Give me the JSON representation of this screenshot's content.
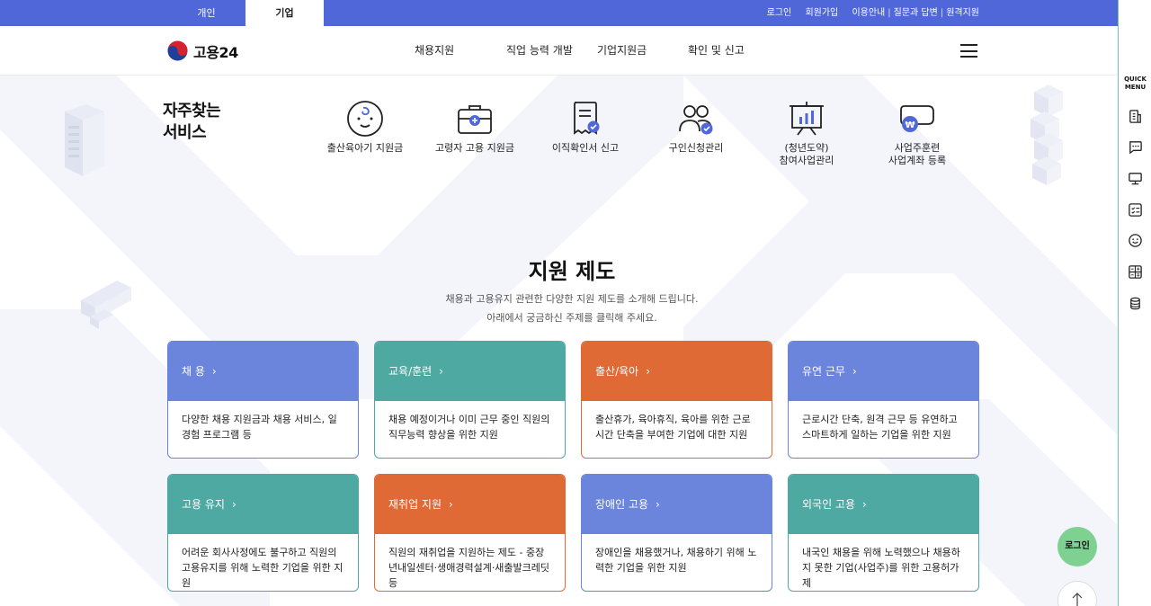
{
  "top_bar": {
    "tabs": [
      {
        "label": "개인"
      },
      {
        "label": "기업"
      }
    ],
    "links": [
      "로그인",
      "회원가입",
      "이용안내",
      "질문과 답변",
      "원격지원"
    ]
  },
  "header": {
    "logo_text": "고용24",
    "nav": [
      "채용지원",
      "직업 능력 개발",
      "기업지원금",
      "확인 및 신고"
    ]
  },
  "frequent_services": {
    "title": "자주찾는\n서비스",
    "items": [
      {
        "label": "출산육아기 지원금",
        "icon": "baby-icon"
      },
      {
        "label": "고령자 고용 지원금",
        "icon": "briefcase-plus-icon"
      },
      {
        "label": "이직확인서 신고",
        "icon": "document-check-icon"
      },
      {
        "label": "구인신청관리",
        "icon": "people-check-icon"
      },
      {
        "label": "(청년도약)\n참여사업관리",
        "icon": "presentation-chart-icon"
      },
      {
        "label": "사업주훈련\n사업계좌 등록",
        "icon": "wallet-won-icon"
      }
    ]
  },
  "support_section": {
    "title": "지원 제도",
    "desc_line1": "채용과 고용유지 관련한 다양한 지원 제도를 소개해 드립니다.",
    "desc_line2": "아래에서 궁금하신 주제를 클릭해 주세요.",
    "cards": [
      {
        "title": "채 용",
        "desc": "다양한 채용 지원금과 채용 서비스, 일 경험 프로그램 등",
        "color": "#6b84dc"
      },
      {
        "title": "교육/훈련",
        "desc": "채용 예정이거나 이미 근무 중인 직원의 직무능력 향상을 위한 지원",
        "color": "#4fa9a3"
      },
      {
        "title": "출산/육아",
        "desc": "출산휴가, 육아휴직, 육아를 위한 근로시간 단축을 부여한 기업에 대한 지원",
        "color": "#e06a35"
      },
      {
        "title": "유연 근무",
        "desc": "근로시간 단축, 원격 근무 등 유연하고 스마트하게 일하는 기업을 위한 지원",
        "color": "#6b84dc"
      },
      {
        "title": "고용 유지",
        "desc": "어려운 회사사정에도 불구하고 직원의 고용유지를 위해 노력한 기업을 위한 지원",
        "color": "#4fa9a3"
      },
      {
        "title": "재취업 지원",
        "desc": "직원의 재취업을 지원하는 제도 - 중장년내일센터·생애경력설계·새출발크레딧 등",
        "color": "#e06a35"
      },
      {
        "title": "장애인 고용",
        "desc": "장애인을 채용했거나, 채용하기 위해 노력한 기업을 위한 지원",
        "color": "#6b84dc"
      },
      {
        "title": "외국인 고용",
        "desc": "내국인 채용을 위해 노력했으나 채용하지 못한 기업(사업주)를 위한 고용허가제",
        "color": "#4fa9a3"
      }
    ]
  },
  "quick_menu": {
    "title_line1": "QUICK",
    "title_line2": "MENU",
    "icons": [
      "building-icon",
      "chat-bubble-icon",
      "monitor-icon",
      "checklist-icon",
      "smile-icon",
      "calculator-icon",
      "coin-stack-icon"
    ]
  },
  "floating": {
    "login_label": "로그인",
    "top_icon": "arrow-up-icon"
  }
}
